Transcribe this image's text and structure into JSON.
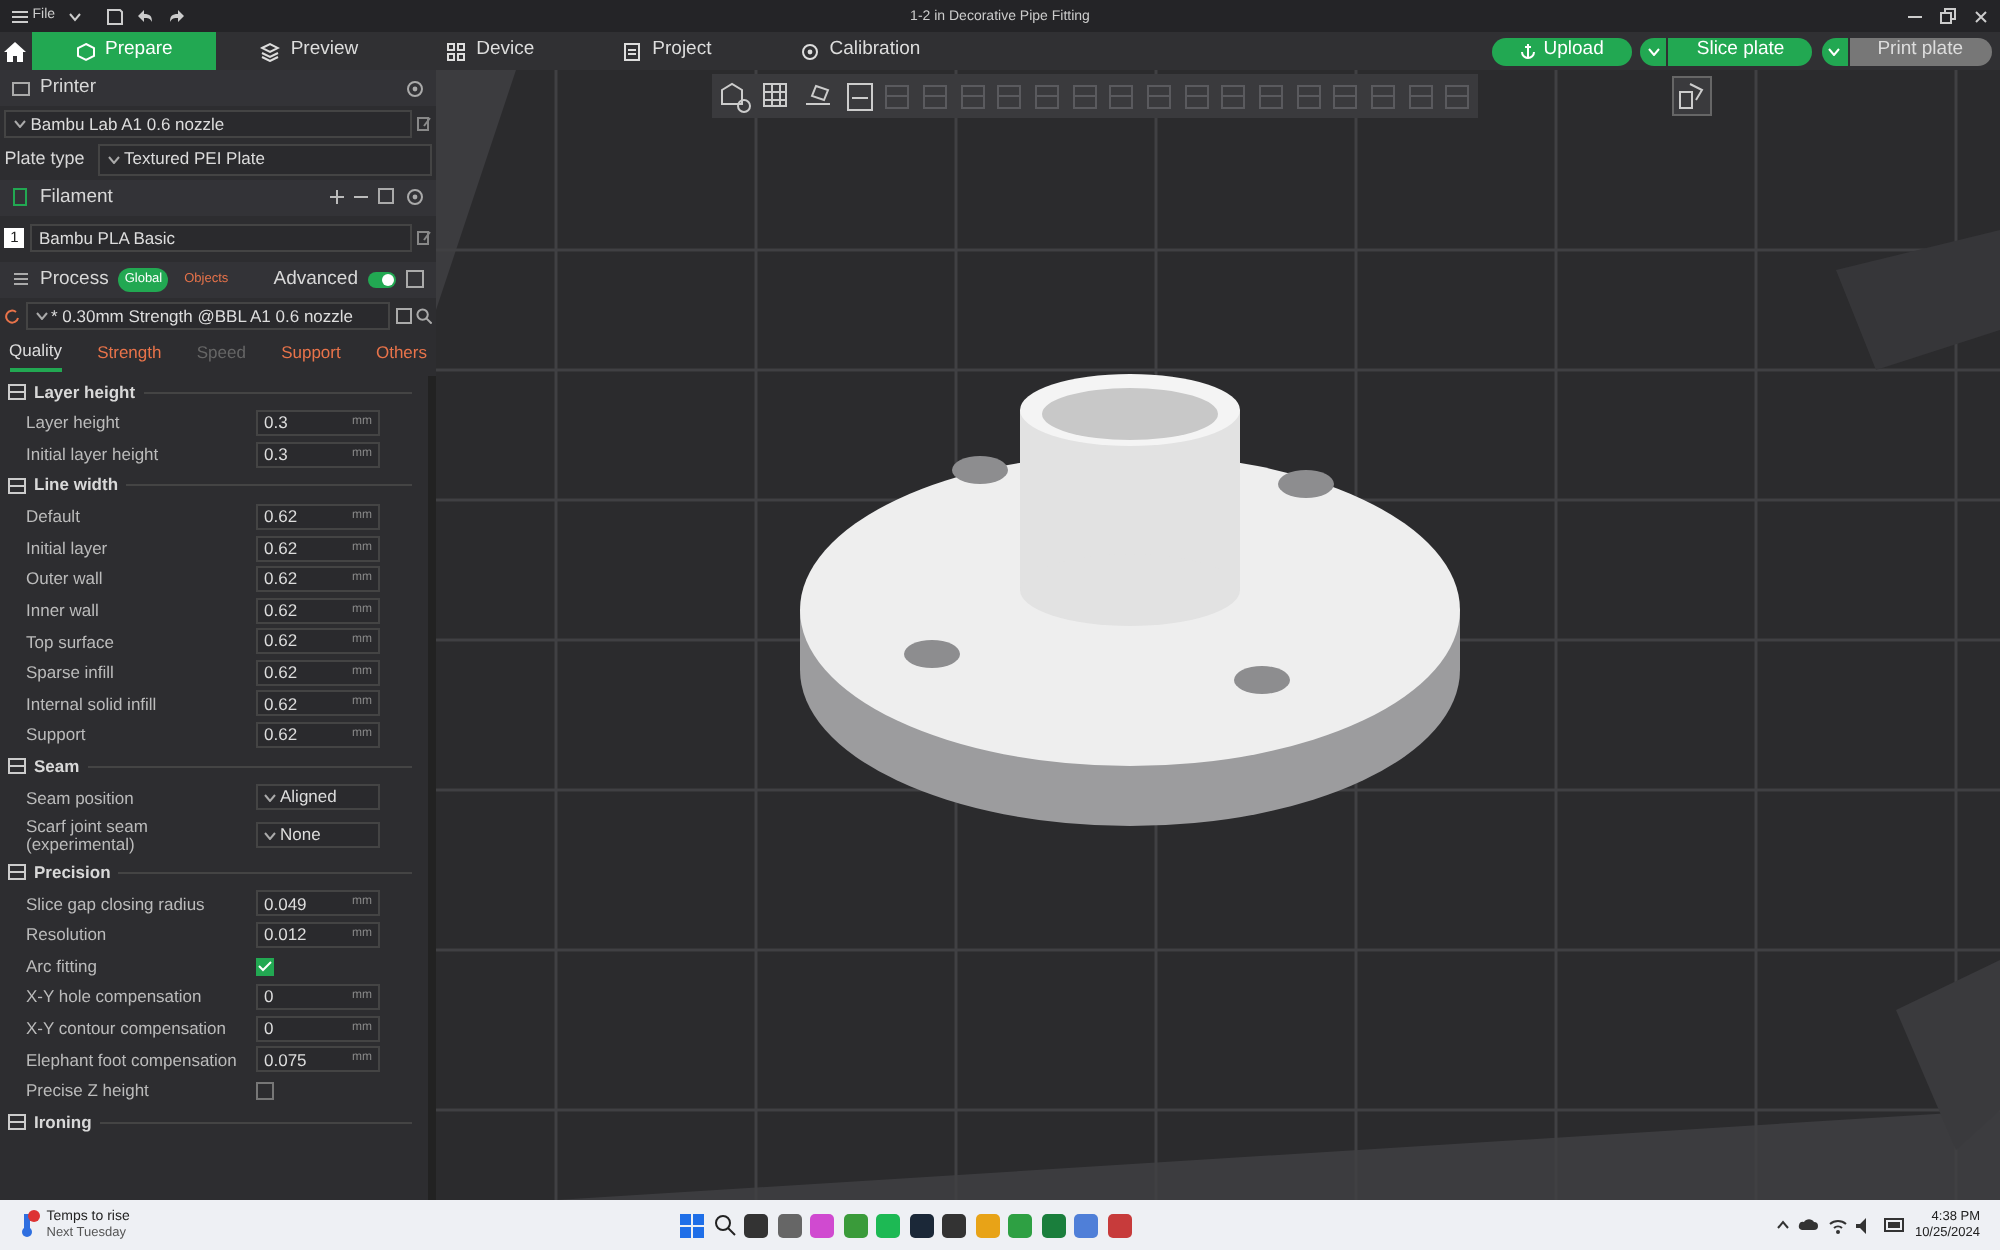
{
  "title_bar": {
    "menu": "File",
    "title": "1-2 in Decorative Pipe Fitting"
  },
  "tabs": [
    {
      "label": "Prepare",
      "selected": true
    },
    {
      "label": "Preview",
      "selected": false
    },
    {
      "label": "Device",
      "selected": false
    },
    {
      "label": "Project",
      "selected": false
    },
    {
      "label": "Calibration",
      "selected": false
    }
  ],
  "actions": [
    {
      "label": "Upload",
      "kind": "plain",
      "disabled": false
    },
    {
      "label": "Slice plate",
      "kind": "split",
      "disabled": false
    },
    {
      "label": "Print plate",
      "kind": "split",
      "disabled": true
    }
  ],
  "printer": {
    "title": "Printer",
    "preset": "Bambu Lab A1 0.6 nozzle",
    "plate_label": "Plate type",
    "plate": "Textured PEI Plate"
  },
  "filament": {
    "title": "Filament",
    "items": [
      {
        "index": "1",
        "name": "Bambu PLA Basic"
      }
    ]
  },
  "process": {
    "title": "Process",
    "scopes": [
      {
        "label": "Global",
        "selected": true
      },
      {
        "label": "Objects",
        "selected": false
      }
    ],
    "advanced_label": "Advanced",
    "advanced": true,
    "preset": "* 0.30mm Strength @BBL A1 0.6 nozzle"
  },
  "setting_tabs": [
    {
      "label": "Quality",
      "selected": true,
      "modified": false,
      "disabled": false
    },
    {
      "label": "Strength",
      "selected": false,
      "modified": true,
      "disabled": false
    },
    {
      "label": "Speed",
      "selected": false,
      "modified": false,
      "disabled": true
    },
    {
      "label": "Support",
      "selected": false,
      "modified": true,
      "disabled": false
    },
    {
      "label": "Others",
      "selected": false,
      "modified": true,
      "disabled": false
    }
  ],
  "groups": [
    {
      "title": "Layer height",
      "rows": [
        {
          "kind": "number",
          "label": "Layer height",
          "value": "0.3",
          "unit": "mm"
        },
        {
          "kind": "number",
          "label": "Initial layer height",
          "value": "0.3",
          "unit": "mm"
        }
      ]
    },
    {
      "title": "Line width",
      "rows": [
        {
          "kind": "number",
          "label": "Default",
          "value": "0.62",
          "unit": "mm"
        },
        {
          "kind": "number",
          "label": "Initial layer",
          "value": "0.62",
          "unit": "mm"
        },
        {
          "kind": "number",
          "label": "Outer wall",
          "value": "0.62",
          "unit": "mm"
        },
        {
          "kind": "number",
          "label": "Inner wall",
          "value": "0.62",
          "unit": "mm"
        },
        {
          "kind": "number",
          "label": "Top surface",
          "value": "0.62",
          "unit": "mm"
        },
        {
          "kind": "number",
          "label": "Sparse infill",
          "value": "0.62",
          "unit": "mm"
        },
        {
          "kind": "number",
          "label": "Internal solid infill",
          "value": "0.62",
          "unit": "mm"
        },
        {
          "kind": "number",
          "label": "Support",
          "value": "0.62",
          "unit": "mm"
        }
      ]
    },
    {
      "title": "Seam",
      "rows": [
        {
          "kind": "select",
          "label": "Seam position",
          "value": "Aligned"
        },
        {
          "kind": "select",
          "label": "Scarf joint seam (experimental)",
          "value": "None"
        }
      ]
    },
    {
      "title": "Precision",
      "rows": [
        {
          "kind": "number",
          "label": "Slice gap closing radius",
          "value": "0.049",
          "unit": "mm"
        },
        {
          "kind": "number",
          "label": "Resolution",
          "value": "0.012",
          "unit": "mm"
        },
        {
          "kind": "check",
          "label": "Arc fitting",
          "checked": true
        },
        {
          "kind": "number",
          "label": "X-Y hole compensation",
          "value": "0",
          "unit": "mm"
        },
        {
          "kind": "number",
          "label": "X-Y contour compensation",
          "value": "0",
          "unit": "mm"
        },
        {
          "kind": "number",
          "label": "Elephant foot compensation",
          "value": "0.075",
          "unit": "mm"
        },
        {
          "kind": "check",
          "label": "Precise Z height",
          "checked": false
        }
      ]
    },
    {
      "title": "Ironing"
    }
  ],
  "taskbar": {
    "weather_title": "Temps to rise",
    "weather_sub": "Next Tuesday",
    "time": "4:38 PM",
    "date": "10/25/2024"
  }
}
